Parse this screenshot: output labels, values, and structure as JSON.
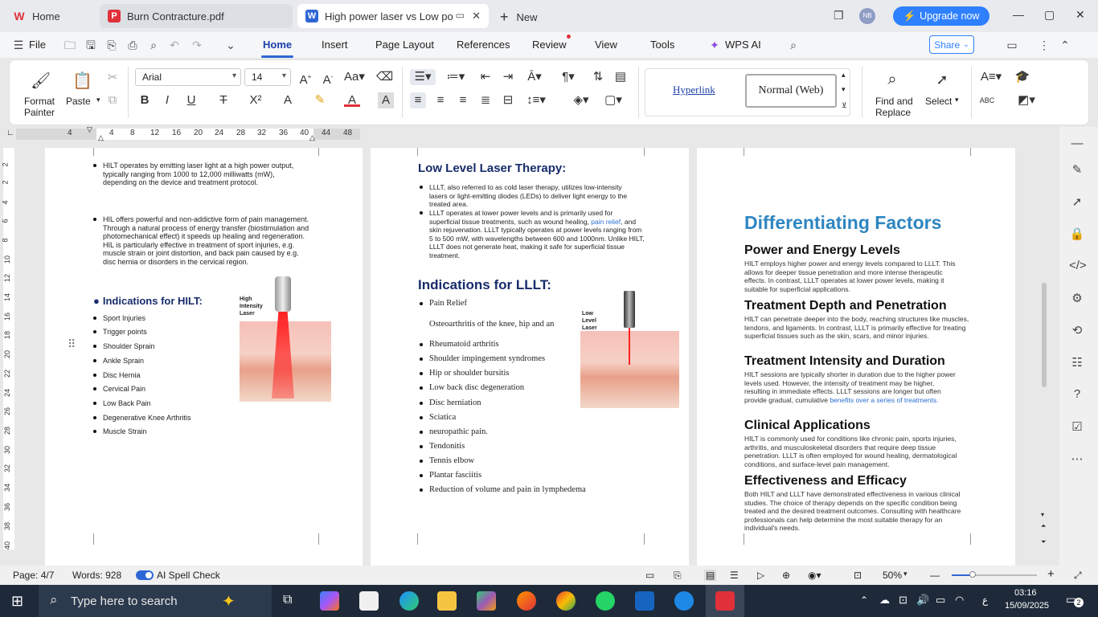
{
  "tabs": [
    {
      "label": "Home"
    },
    {
      "label": "Burn Contracture.pdf"
    },
    {
      "label": "High power laser vs Low powe"
    }
  ],
  "new_tab": "New",
  "upgrade": "Upgrade now",
  "avatar": "NB",
  "menu": {
    "file": "File",
    "items": [
      "Home",
      "Insert",
      "Page Layout",
      "References",
      "Review",
      "View",
      "Tools",
      "WPS AI"
    ],
    "share": "Share"
  },
  "ribbon": {
    "format_painter": "Format\nPainter",
    "paste": "Paste",
    "font": "Arial",
    "size": "14",
    "style_hyperlink": "Hyperlink",
    "style_normal": "Normal (Web)",
    "find_replace": "Find and\nReplace",
    "select": "Select"
  },
  "ruler": [
    "4",
    "4",
    "8",
    "12",
    "16",
    "20",
    "24",
    "28",
    "32",
    "36",
    "40",
    "44",
    "48"
  ],
  "vruler": [
    "2",
    "2",
    "4",
    "6",
    "8",
    "10",
    "12",
    "14",
    "16",
    "18",
    "20",
    "22",
    "24",
    "26",
    "28",
    "30",
    "32",
    "34",
    "36",
    "38",
    "40"
  ],
  "page1": {
    "b1": "HILT operates by emitting laser light at a high power output, typically ranging from 1000 to 12,000 milliwatts (mW), depending on the device and treatment protocol.",
    "b2": "HIL offers powerful and non-addictive form of pain management. Through a natural process of energy transfer (biostimulation and photomechanical effect) it speeds up healing and regeneration. HIL is particularly effective in treatment of sport injuries, e.g. muscle strain or joint distortion, and back pain caused by e.g. disc hernia or disorders in the cervical region.",
    "heading": "Indications for HILT:",
    "list": [
      "Sport Injuries",
      "Trigger points",
      "Shoulder Sprain",
      "Ankle Sprain",
      "Disc Hernia",
      "Cervical Pain",
      "Low Back Pain",
      "Degenerative Knee Arthritis",
      "Muscle Strain"
    ],
    "img_label": "High\nIntensity\nLaser"
  },
  "page2": {
    "heading1": "Low Level Laser Therapy:",
    "b1": "LLLT, also referred to as cold laser therapy, utilizes low-intensity lasers or light-emitting diodes (LEDs) to deliver light energy to the treated area.",
    "b2a": " LLLT operates at lower power levels and is primarily used for superficial tissue treatments, such as wound healing, ",
    "b2link": "pain relief",
    "b2b": ", and skin rejuvenation. LLLT typically operates at power levels ranging from 5 to 500 mW, with wavelengths between 600 and 1000nm. Unlike HILT, LLLT does not generate heat, making it safe for superficial tissue treatment.",
    "heading2": "Indications for LLLT:",
    "list": [
      "Pain Relief",
      "Osteoarthritis of the knee, hip and an",
      "Rheumatoid arthritis",
      "Shoulder impingement syndromes",
      "Hip or shoulder bursitis",
      "Low back disc degeneration",
      "Disc herniation",
      "Sciatica",
      "neuropathic pain.",
      "Tendonitis",
      "Tennis elbow",
      "Plantar fasciitis",
      "Reduction of volume and pain in lymphedema"
    ],
    "img_label": "Low\nLevel\nLaser"
  },
  "page3": {
    "title": "Differentiating Factors",
    "sections": [
      {
        "h": "Power and Energy Levels",
        "p": "HILT employs higher power and energy levels compared to LLLT. This allows for deeper tissue penetration and more intense therapeutic effects. In contrast, LLLT operates at lower power levels, making it suitable for superficial applications."
      },
      {
        "h": "Treatment Depth and Penetration",
        "p": "HILT can penetrate deeper into the body, reaching structures like muscles, tendons, and ligaments. In contrast, LLLT is primarily effective for treating superficial tissues such as the skin, scars, and minor injuries."
      },
      {
        "h": "Treatment Intensity and Duration",
        "p": "HILT sessions are typically shorter in duration due to the higher power levels used. However, the intensity of treatment may be higher, resulting in immediate effects. LLLT sessions are longer but often provide gradual, cumulative ",
        "link": "benefits over a series of treatments."
      },
      {
        "h": "Clinical Applications",
        "p": "HILT is commonly used for conditions like chronic pain, sports injuries, arthritis, and musculoskeletal disorders that require deep tissue penetration. LLLT is often employed for wound healing, dermatological conditions, and surface-level pain management."
      },
      {
        "h": "Effectiveness and Efficacy",
        "p": "Both HILT and LLLT have demonstrated effectiveness in various clinical studies. The choice of therapy depends on the specific condition being treated and the desired treatment outcomes. Consulting with healthcare professionals can help determine the most suitable therapy for an individual's needs."
      }
    ]
  },
  "status": {
    "page": "Page: 4/7",
    "words": "Words: 928",
    "spell": "AI Spell Check",
    "zoom": "50%"
  },
  "taskbar": {
    "search": "Type here to search",
    "time": "03:16",
    "date": "15/09/2025",
    "notif": "2",
    "lang": "ع"
  },
  "colors": {
    "accent": "#2f80ff",
    "wps_red": "#e0303a",
    "heading_blue": "#172c6a",
    "diff_title": "#2e86c1"
  }
}
